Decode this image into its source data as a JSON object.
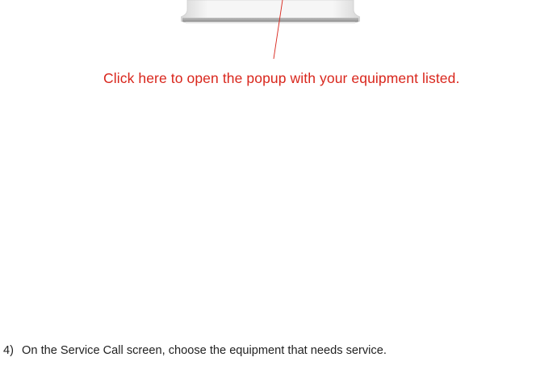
{
  "callout": {
    "text": "Click here to open the popup with your equipment listed.",
    "color": "#d9261c"
  },
  "instruction": {
    "step": "4)",
    "text": "On the Service Call screen, choose the equipment that needs service."
  },
  "device": {
    "icon": "device-stand-icon"
  }
}
